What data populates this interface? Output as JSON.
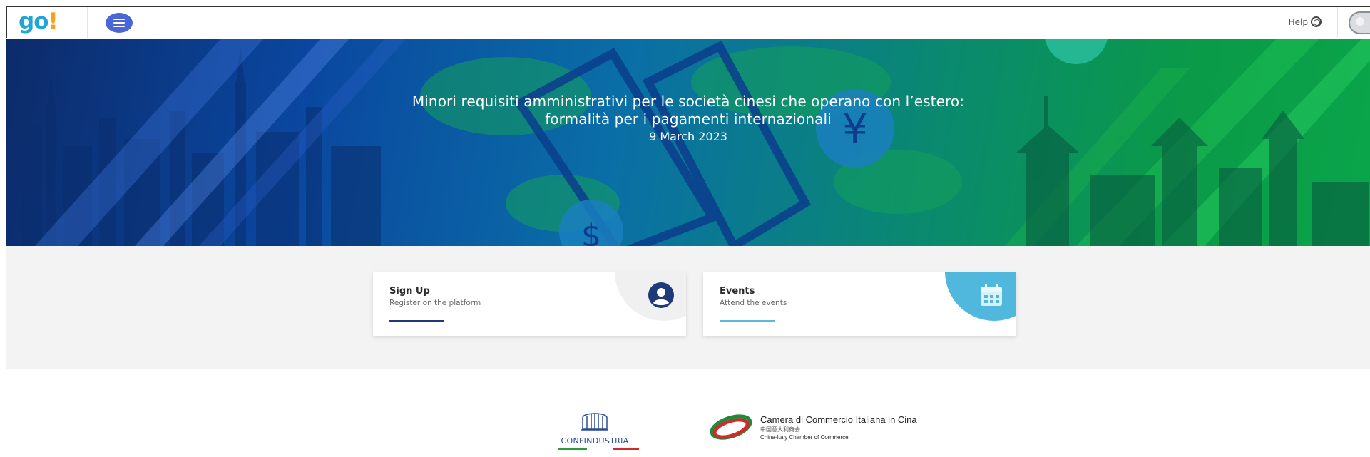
{
  "header": {
    "logo_main": "go",
    "logo_bang": "!",
    "help_label": "Help",
    "icons": {
      "menu": "menu-icon",
      "help": "lifebuoy-icon",
      "avatar": "user-avatar"
    }
  },
  "hero": {
    "title_line1": "Minori requisiti amministrativi per le società cinesi che operano con l’estero:",
    "title_line2": "formalità per i pagamenti internazionali",
    "date": "9 March 2023"
  },
  "cards": {
    "signup": {
      "title": "Sign Up",
      "subtitle": "Register on the platform",
      "icon": "user-circle-icon"
    },
    "events": {
      "title": "Events",
      "subtitle": "Attend the events",
      "icon": "calendar-icon"
    }
  },
  "footer": {
    "confindustria": "CONFINDUSTRIA",
    "ccic_line1": "Camera di Commercio Italiana in Cina",
    "ccic_line2": "中国意大利商会",
    "ccic_line3": "China-Italy Chamber of Commerce"
  },
  "colors": {
    "accent_blue": "#4b67d6",
    "logo_blue": "#1fa6d4",
    "logo_orange": "#f4a21a",
    "events_cyan": "#4fb8dc",
    "signup_navy": "#1e3a7a"
  }
}
